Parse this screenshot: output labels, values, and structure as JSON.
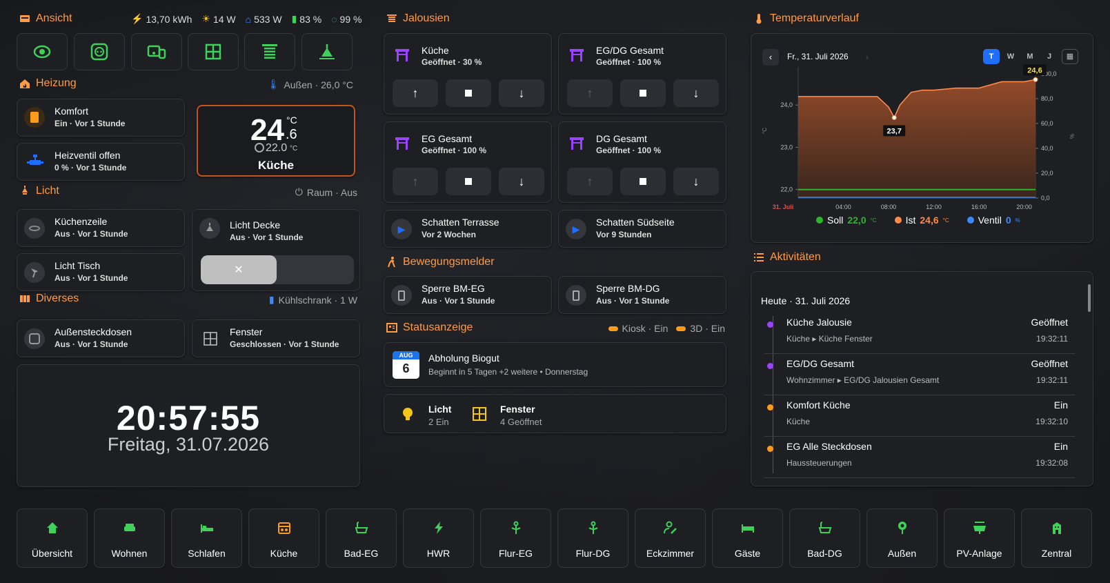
{
  "colors": {
    "accent": "#ff9b45",
    "green": "#3fd15a",
    "purple": "#9b44ff",
    "blue": "#1e6fff",
    "yellow": "#f5c518"
  },
  "ansicht": {
    "title": "Ansicht",
    "stats": [
      {
        "icon": "solar-icon",
        "value": "13,70 kWh"
      },
      {
        "icon": "pv-icon",
        "value": "14 W"
      },
      {
        "icon": "house-power-icon",
        "value": "533 W"
      },
      {
        "icon": "battery-icon",
        "value": "83 %"
      },
      {
        "icon": "circle-progress-icon",
        "value": "99 %"
      }
    ]
  },
  "heizung": {
    "title": "Heizung",
    "outside": "Außen · 26,0 °C",
    "komfort": {
      "label": "Komfort",
      "sub": "Ein · Vor 1 Stunde"
    },
    "ventil": {
      "label": "Heizventil offen",
      "sub": "0 % · Vor 1 Stunde"
    },
    "thermo": {
      "temp_int": "24",
      "temp_dec": ".6",
      "unit": "°C",
      "target": "22.0",
      "target_unit": "°C",
      "room": "Küche"
    }
  },
  "licht": {
    "title": "Licht",
    "right": "Raum · Aus",
    "kuechenzeile": {
      "label": "Küchenzeile",
      "sub": "Aus · Vor 1 Stunde"
    },
    "tisch": {
      "label": "Licht Tisch",
      "sub": "Aus · Vor 1 Stunde"
    },
    "decke": {
      "label": "Licht Decke",
      "sub": "Aus · Vor 1 Stunde"
    }
  },
  "diverses": {
    "title": "Diverses",
    "right": "Kühlschrank · 1 W",
    "steckdosen": {
      "label": "Außensteckdosen",
      "sub": "Aus · Vor 1 Stunde"
    },
    "fenster": {
      "label": "Fenster",
      "sub": "Geschlossen · Vor 1 Stunde"
    }
  },
  "clock": {
    "time": "20:57:55",
    "date": "Freitag, 31.07.2026"
  },
  "jalousien": {
    "title": "Jalousien",
    "items": [
      {
        "label": "Küche",
        "sub": "Geöffnet · 30 %"
      },
      {
        "label": "EG/DG Gesamt",
        "sub": "Geöffnet · 100 %"
      },
      {
        "label": "EG Gesamt",
        "sub": "Geöffnet · 100 %"
      },
      {
        "label": "DG Gesamt",
        "sub": "Geöffnet · 100 %"
      }
    ],
    "schatten": [
      {
        "label": "Schatten Terrasse",
        "sub": "Vor 2 Wochen"
      },
      {
        "label": "Schatten Südseite",
        "sub": "Vor 9 Stunden"
      }
    ]
  },
  "bewegung": {
    "title": "Bewegungsmelder",
    "items": [
      {
        "label": "Sperre BM-EG",
        "sub": "Aus · Vor 1 Stunde"
      },
      {
        "label": "Sperre BM-DG",
        "sub": "Aus · Vor 1 Stunde"
      }
    ]
  },
  "status": {
    "title": "Statusanzeige",
    "kiosk": "Kiosk · Ein",
    "d3": "3D · Ein",
    "event": {
      "month": "AUG",
      "day": "6",
      "title": "Abholung Biogut",
      "sub": "Beginnt in 5 Tagen +2 weitere • Donnerstag"
    },
    "licht": {
      "label": "Licht",
      "sub": "2 Ein"
    },
    "fenster": {
      "label": "Fenster",
      "sub": "4 Geöffnet"
    }
  },
  "temp": {
    "title": "Temperaturverlauf",
    "date": "Fr., 31. Juli 2026",
    "ranges": [
      "T",
      "W",
      "M",
      "J"
    ],
    "yleft": [
      "24,0",
      "23,0",
      "22,0"
    ],
    "yright": [
      "100,0",
      "80,0",
      "60,0",
      "40,0",
      "20,0",
      "0,0"
    ],
    "xticks": [
      "31. Juli",
      "04:00",
      "08:00",
      "12:00",
      "16:00",
      "20:00"
    ],
    "yleft_unit": "°C",
    "yright_unit": "%",
    "max_label": "24,6",
    "min_label": "23,7",
    "legend": [
      {
        "name": "Soll",
        "value": "22,0",
        "unit": "°C",
        "color": "#2cb52c"
      },
      {
        "name": "Ist",
        "value": "24,6",
        "unit": "°C",
        "color": "#ff8a4a"
      },
      {
        "name": "Ventil",
        "value": "0",
        "unit": "%",
        "color": "#3b8bff"
      }
    ]
  },
  "chart_data": {
    "type": "area",
    "series": [
      {
        "name": "Ist",
        "x": [
          "00:00",
          "02:00",
          "04:00",
          "06:00",
          "07:00",
          "08:00",
          "08:30",
          "09:00",
          "10:00",
          "11:00",
          "12:00",
          "14:00",
          "16:00",
          "18:00",
          "20:00",
          "21:00"
        ],
        "values": [
          24.2,
          24.2,
          24.2,
          24.2,
          24.2,
          23.95,
          23.7,
          24.0,
          24.3,
          24.35,
          24.35,
          24.4,
          24.4,
          24.55,
          24.55,
          24.6
        ]
      },
      {
        "name": "Soll",
        "values": [
          22.0,
          22.0,
          22.0,
          22.0,
          22.0,
          22.0,
          22.0,
          22.0,
          22.0,
          22.0,
          22.0,
          22.0,
          22.0,
          22.0,
          22.0,
          22.0
        ]
      },
      {
        "name": "Ventil",
        "values": [
          0,
          0,
          0,
          0,
          0,
          0,
          0,
          0,
          0,
          0,
          0,
          0,
          0,
          0,
          0,
          0
        ]
      }
    ],
    "ylim": [
      21.8,
      24.9
    ]
  },
  "aktivitaeten": {
    "title": "Aktivitäten",
    "header": "Heute · 31. Juli 2026",
    "rows": [
      {
        "title": "Küche Jalousie",
        "state": "Geöffnet",
        "area": "Küche",
        "entity": "Küche Fenster",
        "time": "19:32:11",
        "color": "#9b44ff"
      },
      {
        "title": "EG/DG Gesamt",
        "state": "Geöffnet",
        "area": "Wohnzimmer",
        "entity": "EG/DG Jalousien Gesamt",
        "time": "19:32:11",
        "color": "#9b44ff"
      },
      {
        "title": "Komfort Küche",
        "state": "Ein",
        "area": "Küche",
        "entity": "",
        "time": "19:32:10",
        "color": "#ff9b1a"
      },
      {
        "title": "EG Alle Steckdosen",
        "state": "Ein",
        "area": "Haussteuerungen",
        "entity": "",
        "time": "19:32:08",
        "color": "#ff9b1a"
      }
    ]
  },
  "nav": [
    "Übersicht",
    "Wohnen",
    "Schlafen",
    "Küche",
    "Bad-EG",
    "HWR",
    "Flur-EG",
    "Flur-DG",
    "Eckzimmer",
    "Gäste",
    "Bad-DG",
    "Außen",
    "PV-Anlage",
    "Zentral"
  ]
}
